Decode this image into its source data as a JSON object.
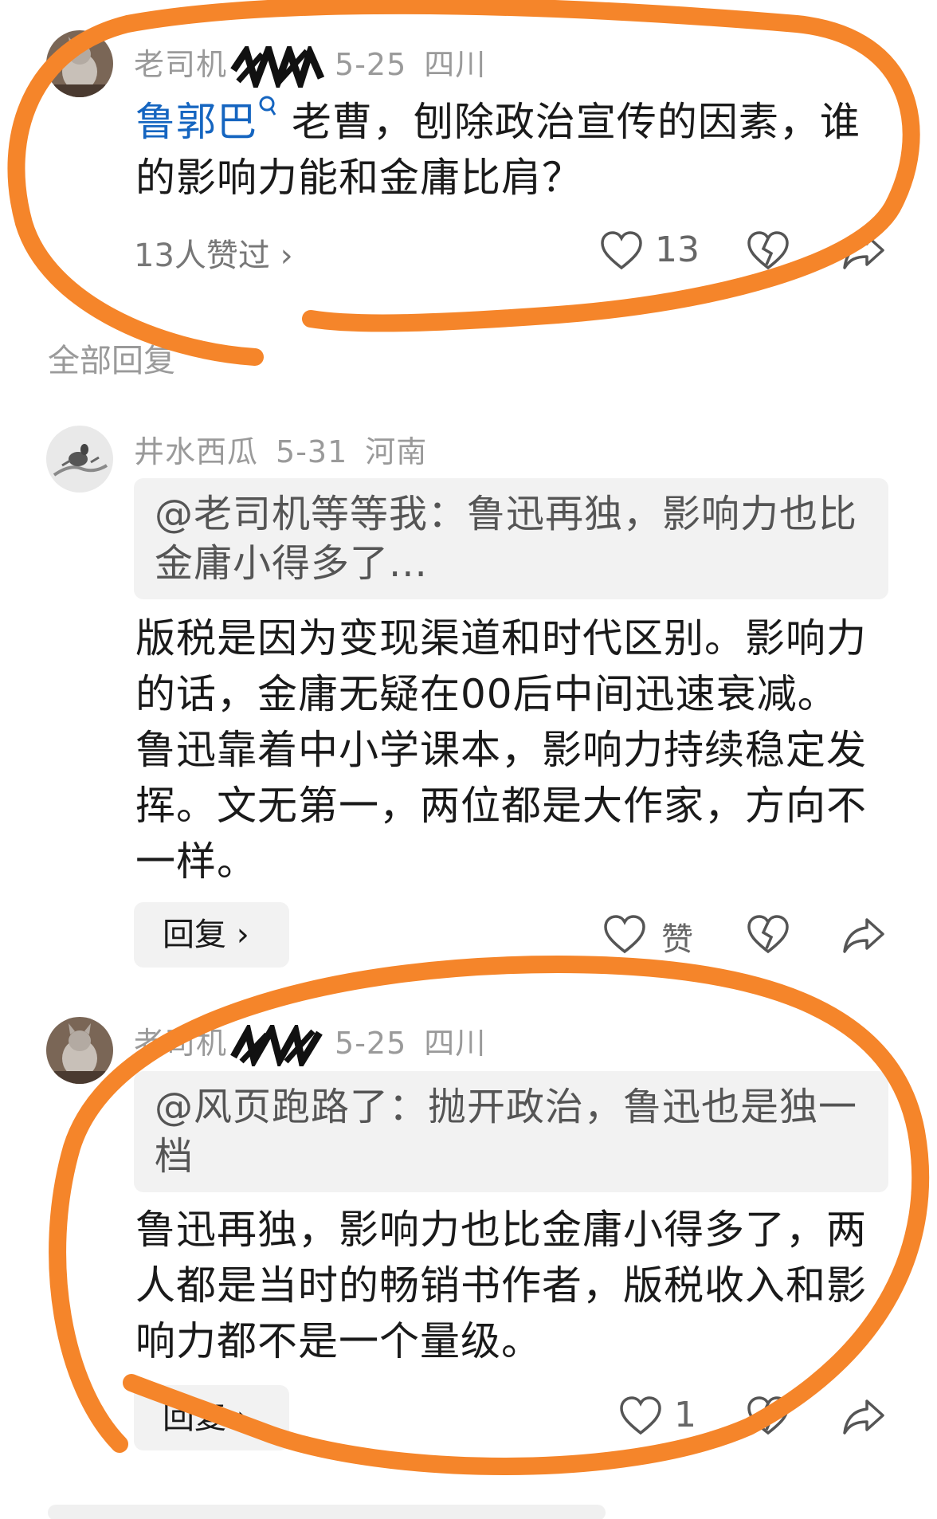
{
  "comment1": {
    "username": "老司机",
    "date": "5-25",
    "location": "四川",
    "mention": "鲁郭巴",
    "text": "老曹，刨除政治宣传的因素，谁的影响力能和金庸比肩？",
    "liked_by": "13人赞过",
    "like_count": "13"
  },
  "section_label": "全部回复",
  "reply1": {
    "username": "井水西瓜",
    "date": "5-31",
    "location": "河南",
    "quote": "@老司机等等我：鲁迅再独，影响力也比金庸小得多了...",
    "text": "版税是因为变现渠道和时代区别。影响力的话，金庸无疑在00后中间迅速衰减。鲁迅靠着中小学课本，影响力持续稳定发挥。文无第一，两位都是大作家，方向不一样。",
    "reply_label": "回复",
    "like_label": "赞"
  },
  "reply2": {
    "username": "老司机",
    "date": "5-25",
    "location": "四川",
    "quote": "@风页跑路了：抛开政治，鲁迅也是独一档",
    "text": "鲁迅再独，影响力也比金庸小得多了，两人都是当时的畅销书作者，版税收入和影响力都不是一个量级。",
    "reply_label": "回复",
    "like_count": "1"
  },
  "annotation_color": "#f5852a"
}
